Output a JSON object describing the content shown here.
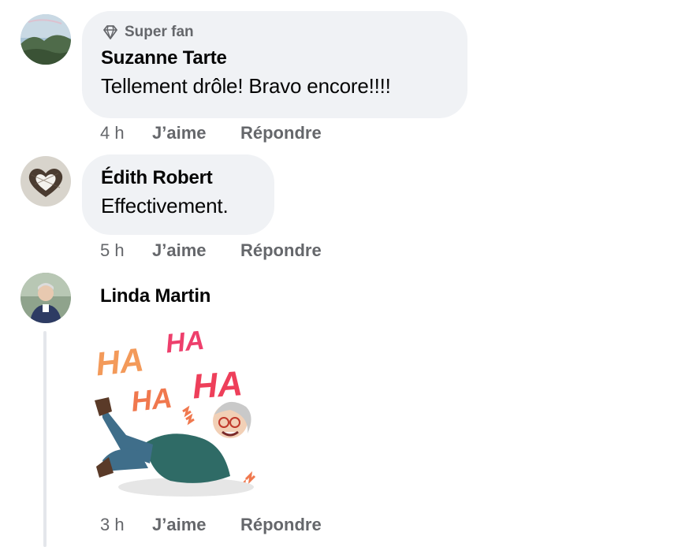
{
  "comments": [
    {
      "badge": "Super fan",
      "author": "Suzanne Tarte",
      "text": "Tellement drôle! Bravo encore!!!!",
      "time": "4 h",
      "like_label": "J’aime",
      "reply_label": "Répondre"
    },
    {
      "author": "Édith Robert",
      "text": "Effectivement.",
      "time": "5 h",
      "like_label": "J’aime",
      "reply_label": "Répondre"
    },
    {
      "author": "Linda Martin",
      "sticker_text": [
        "HA",
        "HA",
        "HA",
        "HA"
      ],
      "time": "3 h",
      "like_label": "J’aime",
      "reply_label": "Répondre"
    }
  ],
  "colors": {
    "bubble": "#f0f2f5",
    "secondary_text": "#65676b",
    "primary_text": "#050505",
    "thread_line": "#e4e6eb"
  },
  "icons": {
    "badge": "diamond-icon"
  }
}
